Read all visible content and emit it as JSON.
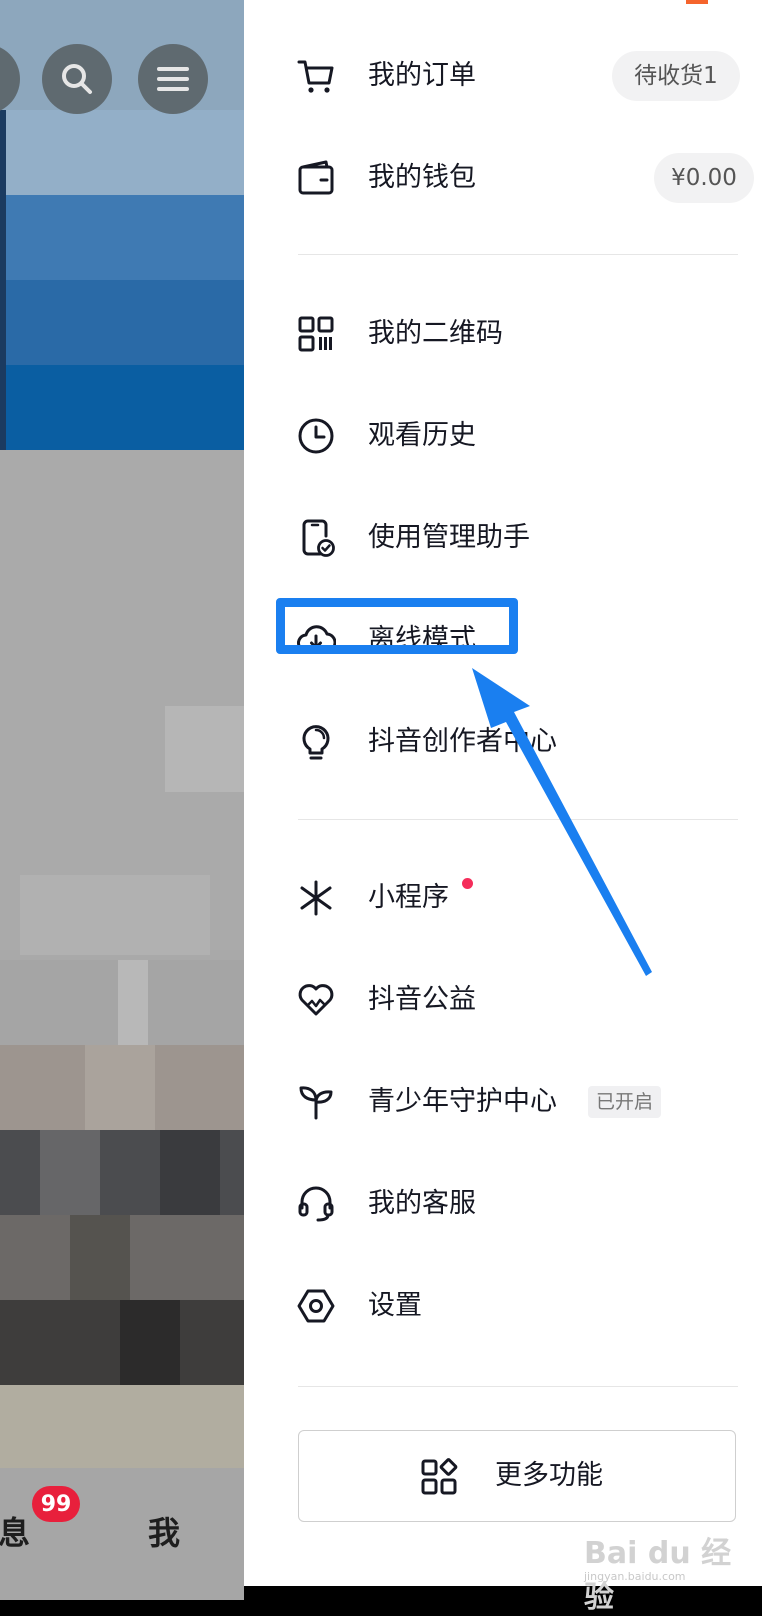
{
  "background": {
    "nav": {
      "messages_label": "消息",
      "messages_badge": "99",
      "me_label": "我"
    },
    "top_icons": [
      "search-icon",
      "menu-icon"
    ]
  },
  "menu": {
    "orders": {
      "label": "我的订单",
      "pill": "待收货1",
      "icon": "cart-icon"
    },
    "wallet": {
      "label": "我的钱包",
      "pill": "¥0.00",
      "icon": "wallet-icon"
    },
    "qrcode": {
      "label": "我的二维码",
      "icon": "qrcode-icon"
    },
    "history": {
      "label": "观看历史",
      "icon": "clock-icon"
    },
    "usage": {
      "label": "使用管理助手",
      "icon": "phone-check-icon"
    },
    "offline": {
      "label": "离线模式",
      "icon": "cloud-download-icon"
    },
    "creator": {
      "label": "抖音创作者中心",
      "icon": "lightbulb-icon"
    },
    "miniprogram": {
      "label": "小程序",
      "icon": "asterisk-icon",
      "has_red_dot": true
    },
    "charity": {
      "label": "抖音公益",
      "icon": "heart-icon"
    },
    "youth": {
      "label": "青少年守护中心",
      "tag": "已开启",
      "icon": "sprout-icon"
    },
    "service": {
      "label": "我的客服",
      "icon": "headset-icon"
    },
    "settings": {
      "label": "设置",
      "icon": "hexagon-gear-icon"
    }
  },
  "more_button": {
    "label": "更多功能",
    "icon": "grid-icon"
  },
  "annotation": {
    "highlight_target": "offline",
    "color": "#1a7ff0"
  },
  "watermark": {
    "text": "Bai du 经验",
    "sub": "jingyan.baidu.com"
  },
  "colors": {
    "accent": "#f5642c",
    "dot": "#f52d5a",
    "text": "#161823"
  }
}
